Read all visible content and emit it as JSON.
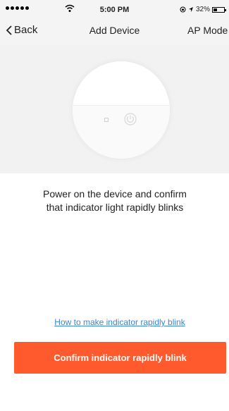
{
  "status_bar": {
    "time": "5:00 PM",
    "battery": "32%",
    "icons": [
      "signal-icon",
      "wifi-icon",
      "location-icon",
      "battery-icon"
    ]
  },
  "nav": {
    "back_label": "Back",
    "title": "Add Device",
    "right_label": "AP Mode"
  },
  "illustration": {
    "icons": [
      "device-illustration",
      "power-icon",
      "indicator-light-icon"
    ]
  },
  "instruction": {
    "line1": "Power on the device and confirm",
    "line2": "that indicator light rapidly blinks"
  },
  "help_link": "How to make indicator rapidly blink",
  "confirm_button": "Confirm indicator rapidly blink",
  "colors": {
    "accent": "#ff5a2d",
    "link": "#3a84d6",
    "header_bg": "#f4f4f4"
  }
}
